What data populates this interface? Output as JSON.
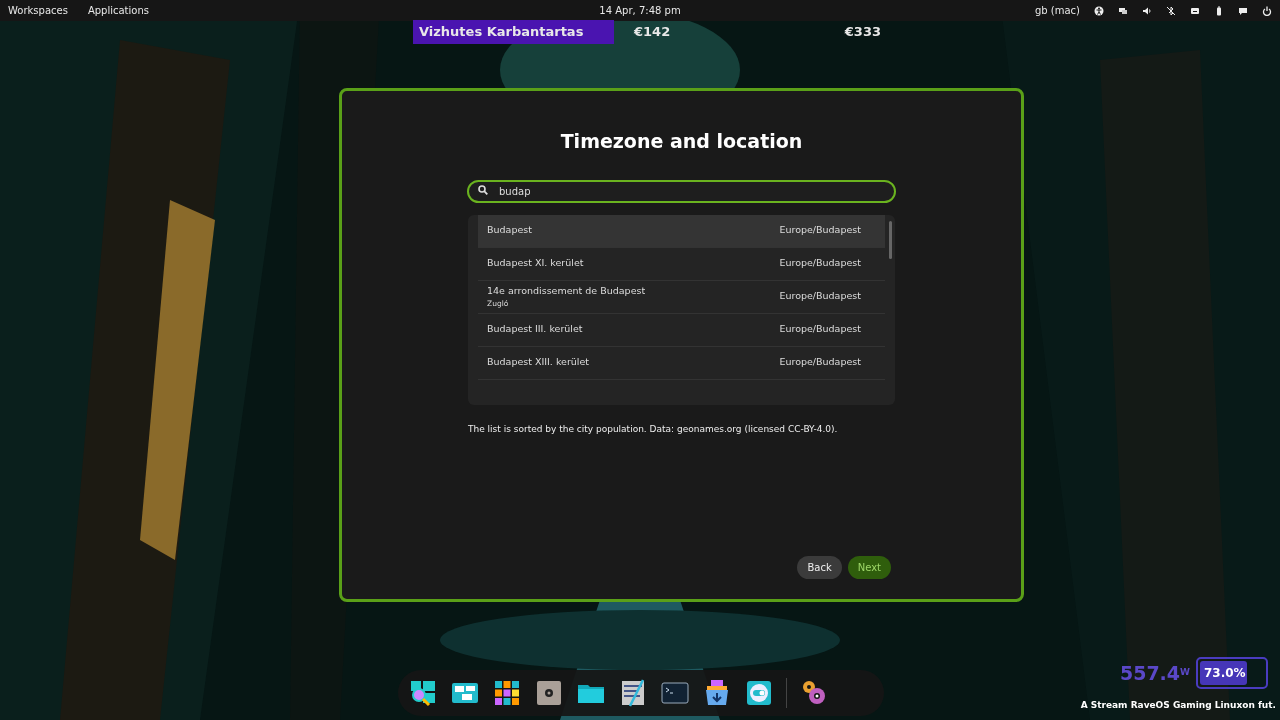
{
  "top_panel": {
    "left": [
      "Workspaces",
      "Applications"
    ],
    "clock": "14 Apr, 7:48 pm",
    "keyboard": "gb (mac)"
  },
  "overlay_bar": {
    "label": "Vizhutes Karbantartas",
    "values": [
      "€142",
      "€333"
    ]
  },
  "dialog": {
    "title": "Timezone and location",
    "search": {
      "value": "budap"
    },
    "results": [
      {
        "city": "Budapest",
        "timezone": "Europe/Budapest",
        "highlighted": true
      },
      {
        "city": "Budapest XI. kerület",
        "timezone": "Europe/Budapest",
        "highlighted": false
      },
      {
        "city": "14e arrondissement de Budapest",
        "subtitle": "Zugló",
        "timezone": "Europe/Budapest",
        "highlighted": false
      },
      {
        "city": "Budapest III. kerület",
        "timezone": "Europe/Budapest",
        "highlighted": false
      },
      {
        "city": "Budapest XIII. kerület",
        "timezone": "Europe/Budapest",
        "highlighted": false
      }
    ],
    "note": "The list is sorted by the city population. Data: geonames.org (licensed CC-BY-4.0).",
    "buttons": [
      {
        "label": "Back",
        "disabled": false
      },
      {
        "label": "Next",
        "disabled": true
      }
    ]
  },
  "power_widget": {
    "watts": "557.4$^{W}$",
    "battery": {
      "level": 0.73,
      "reading": "73.0%"
    },
    "caption": "A Stream RaveOS Gaming Linuxon fut."
  }
}
